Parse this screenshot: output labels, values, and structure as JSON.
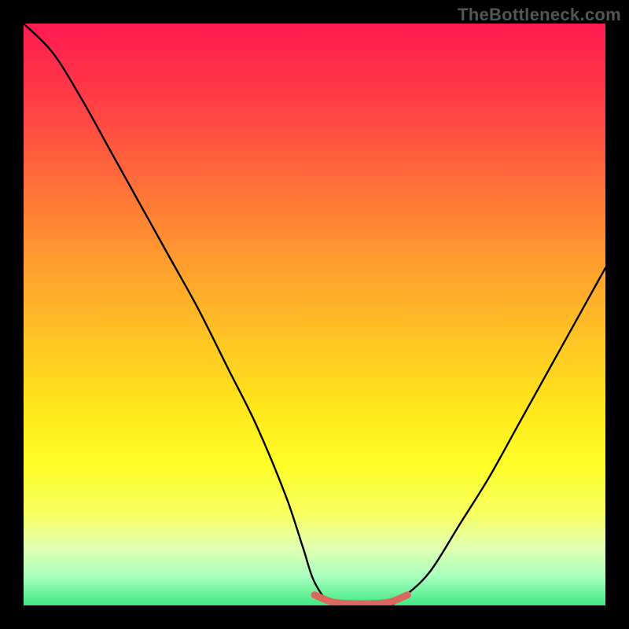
{
  "watermark": "TheBottleneck.com",
  "colors": {
    "frame_bg": "#000000",
    "curve_stroke": "#000000",
    "highlight_stroke": "#d9685f",
    "gradient_stops": [
      "#ff1a50",
      "#ff3a46",
      "#ff6a3a",
      "#ff9a2f",
      "#ffc425",
      "#ffe61c",
      "#feff28",
      "#f8ff60",
      "#e2ffb0",
      "#a8ffbf",
      "#40e884"
    ]
  },
  "chart_data": {
    "type": "line",
    "title": "",
    "xlabel": "",
    "ylabel": "",
    "xlim": [
      0,
      1
    ],
    "ylim": [
      0,
      1
    ],
    "series": [
      {
        "name": "bottleneck-curve",
        "x": [
          0.0,
          0.05,
          0.1,
          0.15,
          0.2,
          0.25,
          0.3,
          0.35,
          0.4,
          0.45,
          0.48,
          0.5,
          0.53,
          0.56,
          0.6,
          0.63,
          0.66,
          0.7,
          0.75,
          0.8,
          0.85,
          0.9,
          0.95,
          1.0
        ],
        "y": [
          1.0,
          0.95,
          0.87,
          0.78,
          0.69,
          0.6,
          0.51,
          0.41,
          0.31,
          0.19,
          0.1,
          0.04,
          0.0,
          0.0,
          0.0,
          0.0,
          0.02,
          0.06,
          0.14,
          0.22,
          0.31,
          0.4,
          0.49,
          0.58
        ]
      },
      {
        "name": "bottleneck-flat-highlight",
        "x": [
          0.5,
          0.53,
          0.56,
          0.6,
          0.63,
          0.66
        ],
        "y": [
          0.018,
          0.006,
          0.003,
          0.003,
          0.006,
          0.018
        ]
      }
    ],
    "annotations": [],
    "legend": []
  }
}
